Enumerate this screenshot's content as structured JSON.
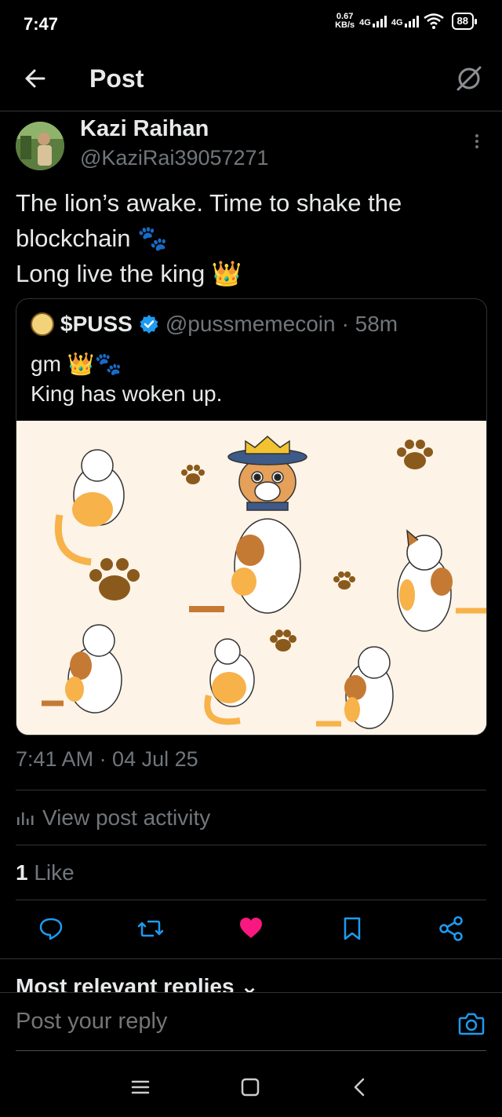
{
  "status_bar": {
    "time": "7:47",
    "speed_value": "0.67",
    "speed_unit": "KB/s",
    "net1": "4G",
    "net2": "4G",
    "battery": "88"
  },
  "header": {
    "title": "Post"
  },
  "post": {
    "author_name": "Kazi Raihan",
    "author_handle": "@KaziRai39057271",
    "text_lines": [
      "The lion’s awake. Time to shake the",
      "blockchain 🐾",
      "Long live the king 👑"
    ],
    "timestamp": "7:41 AM · 04 Jul 25",
    "view_activity_label": "View post activity",
    "like_count": "1",
    "like_label": "Like"
  },
  "quoted": {
    "name": "$PUSS",
    "handle": "@pussmemecoin",
    "age": "· 58m",
    "lines": [
      "gm 👑🐾",
      "King has woken up."
    ]
  },
  "replies": {
    "header": "Most relevant replies ⌄"
  },
  "reply_bar": {
    "placeholder": "Post your reply"
  },
  "colors": {
    "accent": "#1d9bf0",
    "like": "#f91880",
    "muted": "#71767b",
    "image_bg": "#fdf3e6"
  },
  "icons": {
    "back": "arrow-left-icon",
    "header_action": "slashed-circle-icon",
    "more": "more-vertical-icon",
    "verified": "verified-badge-icon",
    "activity": "bar-chart-icon",
    "reply": "speech-bubble-icon",
    "repost": "repost-arrows-icon",
    "like": "heart-filled-icon",
    "bookmark": "bookmark-icon",
    "share": "share-icon",
    "camera": "camera-icon"
  }
}
